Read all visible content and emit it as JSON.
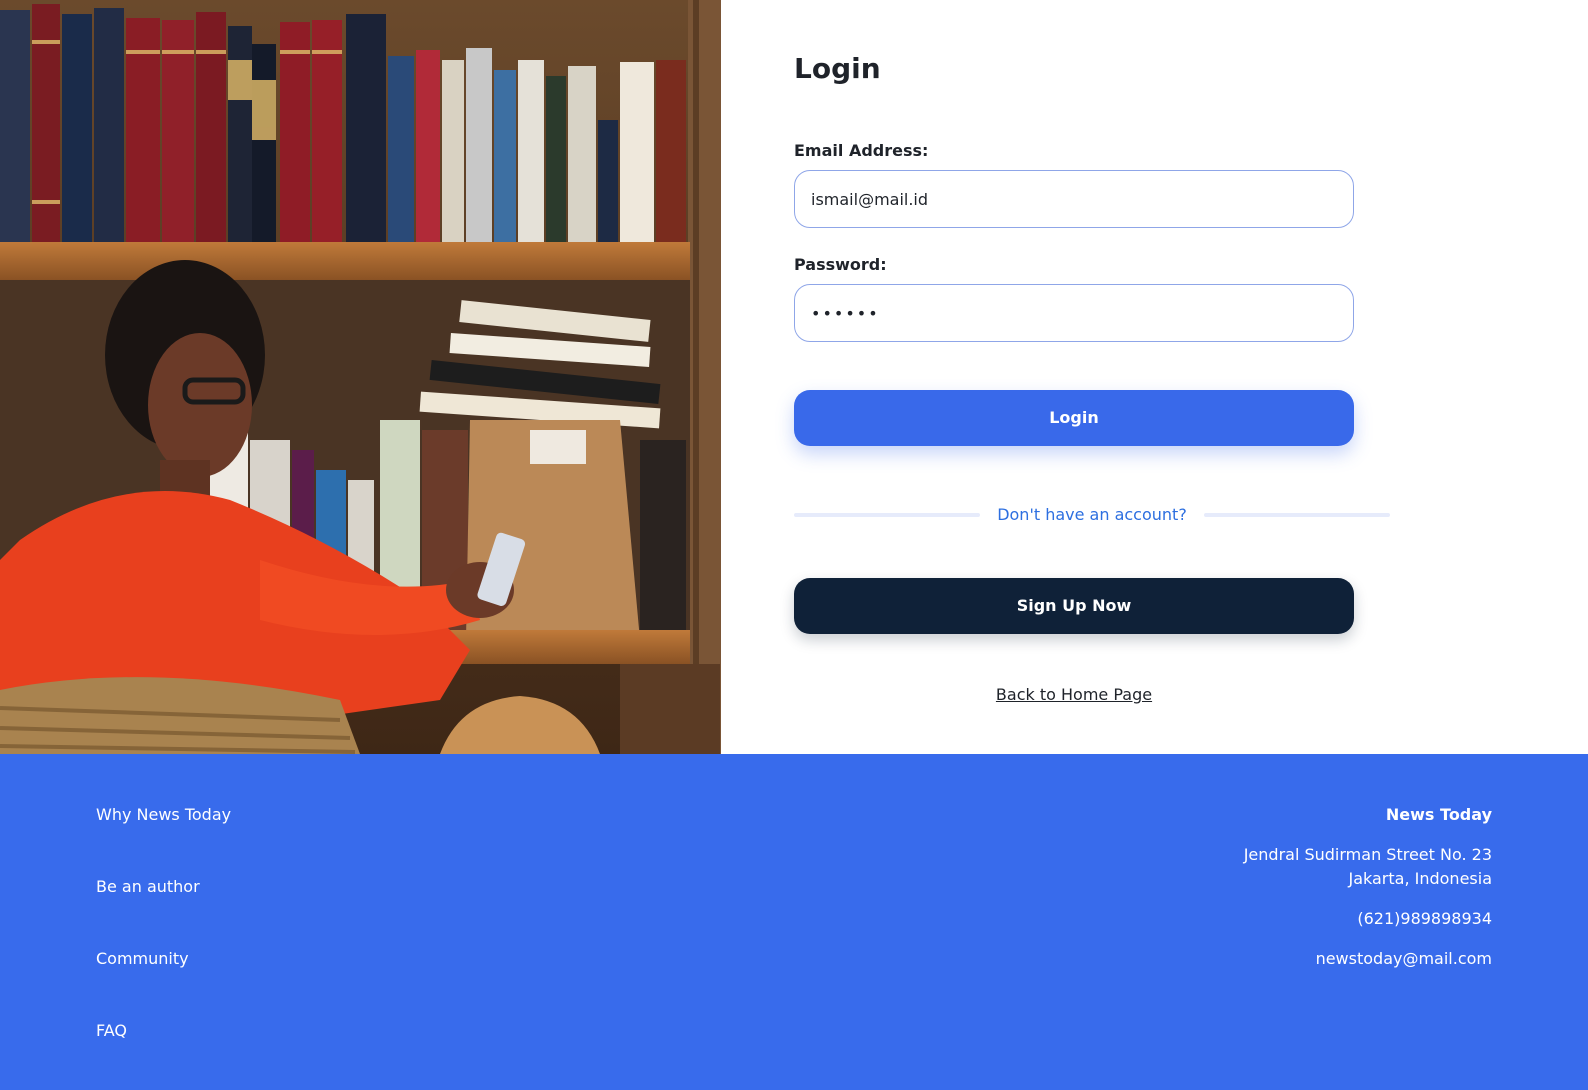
{
  "login": {
    "title": "Login",
    "email_label": "Email Address:",
    "email_value": "ismail@mail.id",
    "password_label": "Password:",
    "password_value": "••••••",
    "login_button": "Login",
    "divider_text": "Don't have an account?",
    "signup_button": "Sign Up Now",
    "back_link": "Back to Home Page"
  },
  "footer": {
    "links": [
      "Why News Today",
      "Be an author",
      "Community",
      "FAQ"
    ],
    "brand": "News Today",
    "address_line1": "Jendral Sudirman Street No. 23",
    "address_line2": "Jakarta, Indonesia",
    "phone": "(621)989898934",
    "email": "newstoday@mail.com"
  },
  "colors": {
    "accent": "#3969ea",
    "dark_button": "#0f2138",
    "footer_bg": "#386bec",
    "link_blue": "#2d6fe0"
  }
}
